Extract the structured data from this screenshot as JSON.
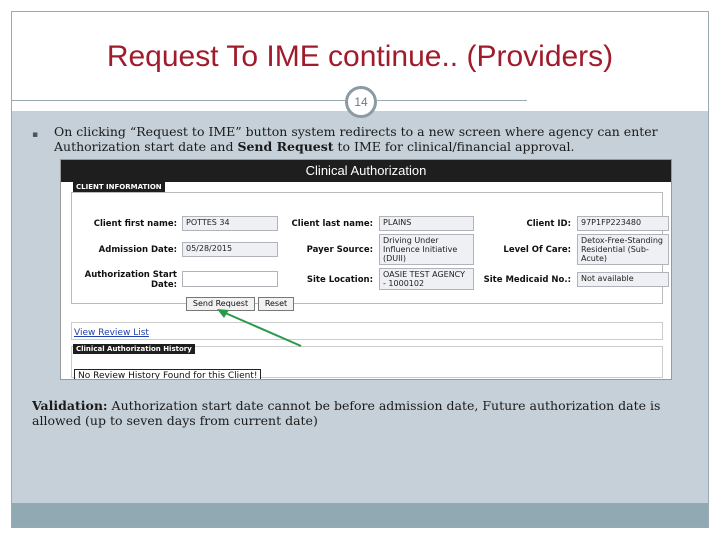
{
  "slide": {
    "title": "Request To IME continue.. (Providers)",
    "page_number": "14",
    "bullet": {
      "text_before": "On clicking “Request to IME” button system redirects to a new screen where agency can enter Authorization start date and ",
      "bold": "Send Request",
      "text_after": " to IME for clinical/financial approval."
    },
    "validation": {
      "label": "Validation:",
      "text": " Authorization start date cannot be before admission date, Future authorization date is allowed (up to seven days from current date)"
    }
  },
  "screen": {
    "title": "Clinical Authorization",
    "section_client_info": "CLIENT INFORMATION",
    "labels": {
      "first_name": "Client first name:",
      "last_name": "Client last name:",
      "client_id": "Client ID:",
      "admission_date": "Admission Date:",
      "payer_source": "Payer Source:",
      "level_of_care": "Level Of Care:",
      "auth_start_date": "Authorization Start Date:",
      "site_location": "Site Location:",
      "site_medicaid": "Site Medicaid No.:"
    },
    "values": {
      "first_name": "POTTES 34",
      "last_name": "PLAINS",
      "client_id": "97P1FP223480",
      "admission_date": "05/28/2015",
      "payer_source": "Driving Under Influence Initiative (DUII)",
      "level_of_care": "Detox-Free-Standing Residential (Sub-Acute)",
      "auth_start_date": "",
      "site_location": "OASIE TEST AGENCY - 1000102",
      "site_medicaid": "Not available"
    },
    "buttons": {
      "send_request": "Send Request",
      "reset": "Reset"
    },
    "view_review_link": "View Review List",
    "section_history": "Clinical Authorization History",
    "no_history": "No Review History Found for this Client!"
  },
  "colors": {
    "title": "#a01c2c",
    "slide_bg": "#c5d0d8",
    "footer": "#91a9b2",
    "arrow": "#2a9a4a"
  }
}
